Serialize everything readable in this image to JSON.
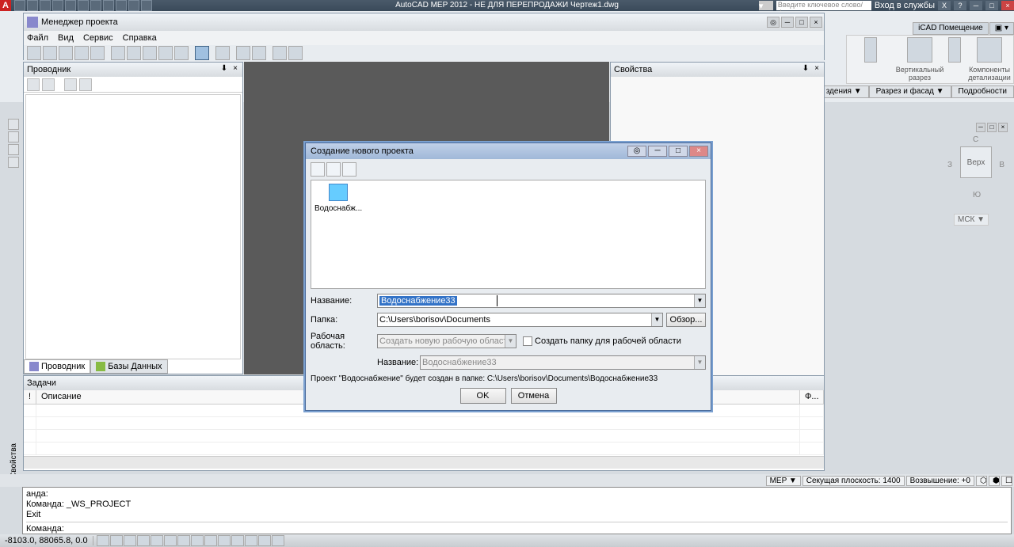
{
  "app": {
    "title": "AutoCAD MEP 2012 - НЕ ДЛЯ ПЕРЕПРОДАЖИ   Чертеж1.dwg",
    "search_placeholder": "Введите ключевое слово/фразу",
    "login": "Вход в службы"
  },
  "ribbon": {
    "tab1": "iCAD Помещение",
    "panel1": "Вертикальный разрез",
    "panel2": "Компоненты детализации",
    "bot1": "здения ▼",
    "bot2": "Разрез и фасад ▼",
    "bot3": "Подробности"
  },
  "pm": {
    "title": "Менеджер проекта",
    "menu": {
      "file": "Файл",
      "view": "Вид",
      "service": "Сервис",
      "help": "Справка"
    }
  },
  "explorer": {
    "title": "Проводник",
    "tab1": "Проводник",
    "tab2": "Базы Данных"
  },
  "tasks": {
    "title": "Задачи",
    "col_bang": "!",
    "col_desc": "Описание",
    "col_f": "Ф..."
  },
  "props": {
    "title": "Свойства"
  },
  "dialog": {
    "title": "Создание нового проекта",
    "item1": "Водоснабж...",
    "label_name": "Название:",
    "name_value": "Водоснабжение33",
    "label_folder": "Папка:",
    "folder_value": "C:\\Users\\borisov\\Documents",
    "browse": "Обзор...",
    "label_workspace": "Рабочая область:",
    "workspace_value": "Создать новую рабочую область",
    "chk_label": "Создать папку для рабочей области",
    "label_ws_name": "Название:",
    "ws_name_value": "Водоснабжение33",
    "info": "Проект \"Водоснабжение\" будет создан в папке: C:\\Users\\borisov\\Documents\\Водоснабжение33",
    "ok": "OK",
    "cancel": "Отмена"
  },
  "viewcube": {
    "face": "Верх",
    "n": "С",
    "s": "Ю",
    "e": "В",
    "w": "З",
    "wcs": "МСК ▼"
  },
  "cmd": {
    "l1": "анда:",
    "l2": "Команда: _WS_PROJECT",
    "l3": "Exit",
    "prompt": "Команда:"
  },
  "statusbar": {
    "coords": "-8103.0, 88065.8, 0.0"
  },
  "status_extra": {
    "r1": "MEP ▼",
    "r2": "Секущая плоскость: 1400",
    "r3": "Возвышение: +0"
  },
  "left_vert": "Свойства"
}
